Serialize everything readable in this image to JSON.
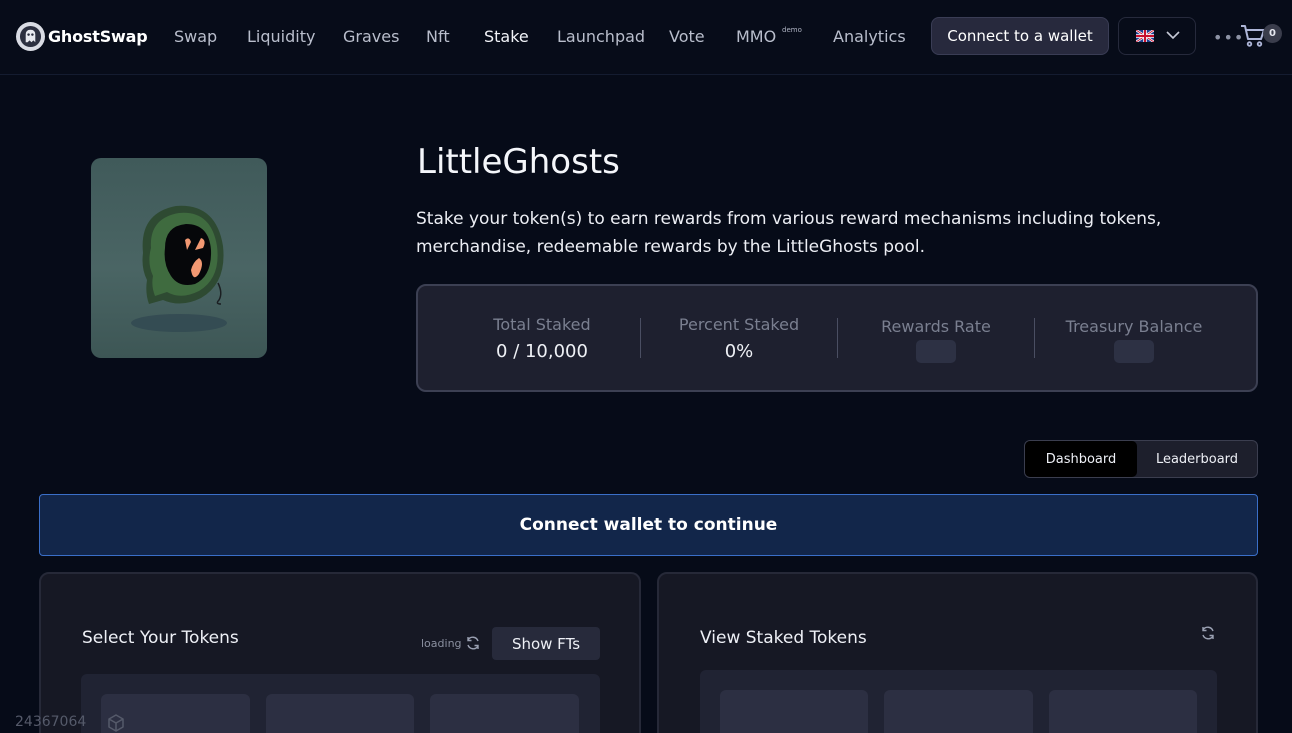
{
  "header": {
    "brand": "GhostSwap",
    "nav": [
      {
        "label": "Swap",
        "active": false
      },
      {
        "label": "Liquidity",
        "active": false
      },
      {
        "label": "Graves",
        "active": false
      },
      {
        "label": "Nft",
        "active": false
      },
      {
        "label": "Stake",
        "active": true
      },
      {
        "label": "Launchpad",
        "active": false
      },
      {
        "label": "Vote",
        "active": false
      },
      {
        "label": "MMO",
        "active": false,
        "badge": "demo"
      },
      {
        "label": "Analytics",
        "active": false
      }
    ],
    "connect_label": "Connect to a wallet",
    "language_icon": "uk-flag-icon",
    "cart_count": "0"
  },
  "pool": {
    "title": "LittleGhosts",
    "description": "Stake your token(s) to earn rewards from various reward mechanisms including tokens, merchandise, redeemable rewards by the LittleGhosts pool.",
    "stats": [
      {
        "label": "Total Staked",
        "value": "0 / 10,000"
      },
      {
        "label": "Percent Staked",
        "value": "0%"
      },
      {
        "label": "Rewards Rate",
        "value": null
      },
      {
        "label": "Treasury Balance",
        "value": null
      }
    ]
  },
  "tabs": [
    {
      "label": "Dashboard",
      "active": true
    },
    {
      "label": "Leaderboard",
      "active": false
    }
  ],
  "banner": {
    "text": "Connect wallet to continue"
  },
  "panels": {
    "select": {
      "title": "Select Your Tokens",
      "status": "loading",
      "button": "Show FTs"
    },
    "staked": {
      "title": "View Staked Tokens"
    }
  },
  "footer": {
    "id": "24367064"
  },
  "colors": {
    "background": "#060b18",
    "banner_bg": "#12264a",
    "banner_border": "#3a6fc8",
    "panel_bg": "#161824"
  }
}
